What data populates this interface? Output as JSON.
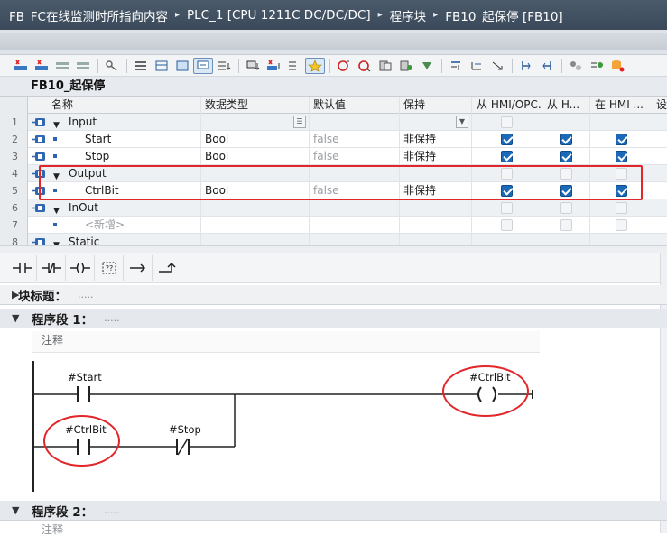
{
  "titlebar": {
    "crumbs": [
      "FB_FC在线监测时所指向内容",
      "PLC_1 [CPU 1211C DC/DC/DC]",
      "程序块",
      "FB10_起保停 [FB10]"
    ],
    "separator": "▸"
  },
  "block": {
    "name": "FB10_起保停"
  },
  "interface": {
    "columns": [
      "名称",
      "数据类型",
      "默认值",
      "保持",
      "从 HMI/OPC...",
      "从 H...",
      "在 HMI ...",
      "设"
    ],
    "rows": [
      {
        "num": "1",
        "kind": "section",
        "name": "Input",
        "datatype": "",
        "default": "",
        "retain": "",
        "hmi1": "disabled",
        "hmi2": "",
        "hmi3": ""
      },
      {
        "num": "2",
        "kind": "var",
        "name": "Start",
        "datatype": "Bool",
        "default": "false",
        "retain": "非保持",
        "hmi1": "on",
        "hmi2": "on",
        "hmi3": "on"
      },
      {
        "num": "3",
        "kind": "var",
        "name": "Stop",
        "datatype": "Bool",
        "default": "false",
        "retain": "非保持",
        "hmi1": "on",
        "hmi2": "on",
        "hmi3": "on"
      },
      {
        "num": "4",
        "kind": "section",
        "name": "Output",
        "datatype": "",
        "default": "",
        "retain": "",
        "hmi1": "disabled",
        "hmi2": "disabled",
        "hmi3": "disabled"
      },
      {
        "num": "5",
        "kind": "var",
        "name": "CtrlBit",
        "datatype": "Bool",
        "default": "false",
        "retain": "非保持",
        "hmi1": "on",
        "hmi2": "on",
        "hmi3": "on"
      },
      {
        "num": "6",
        "kind": "section",
        "name": "InOut",
        "datatype": "",
        "default": "",
        "retain": "",
        "hmi1": "disabled",
        "hmi2": "disabled",
        "hmi3": "disabled"
      },
      {
        "num": "7",
        "kind": "add",
        "name": "<新增>",
        "datatype": "",
        "default": "",
        "retain": "",
        "hmi1": "disabled",
        "hmi2": "disabled",
        "hmi3": "disabled"
      },
      {
        "num": "8",
        "kind": "section",
        "name": "Static",
        "datatype": "",
        "default": "",
        "retain": "",
        "hmi1": "",
        "hmi2": "",
        "hmi3": ""
      }
    ]
  },
  "editor": {
    "block_title_label": "块标题：",
    "block_title_dots": ".....",
    "networks": [
      {
        "label": "程序段 1：",
        "dots": ".....",
        "comment": "注释",
        "ops": {
          "start": "#Start",
          "ctrlbit_coil": "#CtrlBit",
          "ctrlbit_contact": "#CtrlBit",
          "stop": "#Stop"
        }
      },
      {
        "label": "程序段 2：",
        "dots": ".....",
        "comment": "注释"
      }
    ]
  },
  "colors": {
    "highlight": "#e2262a",
    "accent": "#1c6ab7",
    "title_bg": "#3f4e5f"
  }
}
